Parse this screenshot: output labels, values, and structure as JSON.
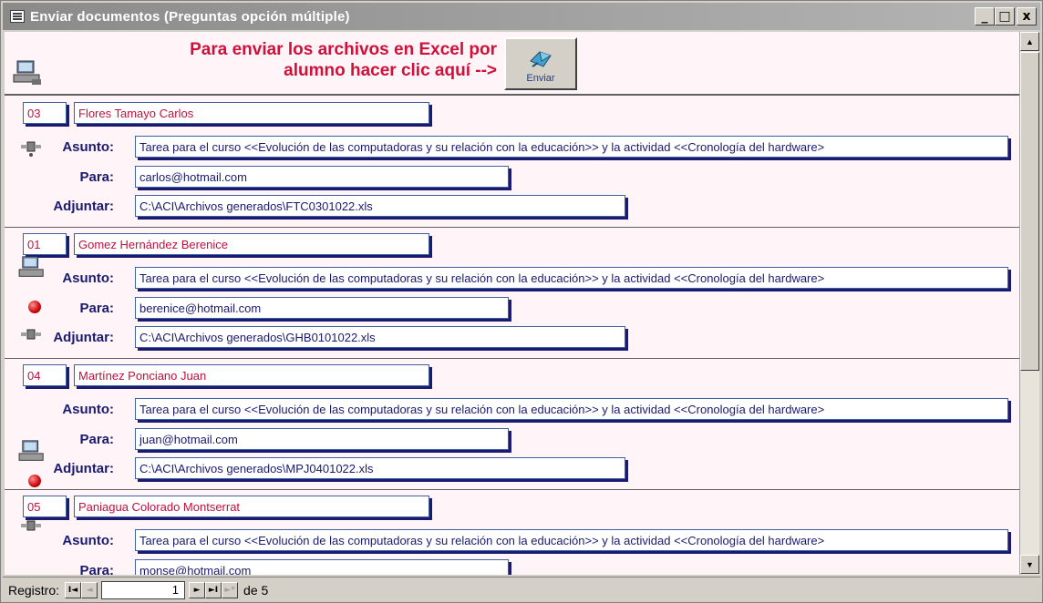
{
  "window": {
    "title": "Enviar documentos (Preguntas opción múltiple)",
    "minimize": "_",
    "maximize": "□",
    "close": "x"
  },
  "header": {
    "message": "Para enviar los archivos en Excel por alumno hacer clic aquí -->",
    "send_button_label": "Enviar"
  },
  "labels": {
    "asunto": "Asunto:",
    "para": "Para:",
    "adjuntar": "Adjuntar:"
  },
  "records": [
    {
      "num": "03",
      "name": "Flores Tamayo Carlos",
      "asunto": "Tarea para el curso <<Evolución de las computadoras y su relación con la educación>> y la actividad <<Cronología del hardware>",
      "para": "carlos@hotmail.com",
      "adjuntar": "C:\\ACI\\Archivos generados\\FTC0301022.xls"
    },
    {
      "num": "01",
      "name": "Gomez Hernández Berenice",
      "asunto": "Tarea para el curso <<Evolución de las computadoras y su relación con la educación>> y la actividad <<Cronología del hardware>",
      "para": "berenice@hotmail.com",
      "adjuntar": "C:\\ACI\\Archivos generados\\GHB0101022.xls"
    },
    {
      "num": "04",
      "name": "Martínez Ponciano Juan",
      "asunto": "Tarea para el curso <<Evolución de las computadoras y su relación con la educación>> y la actividad <<Cronología del hardware>",
      "para": "juan@hotmail.com",
      "adjuntar": "C:\\ACI\\Archivos generados\\MPJ0401022.xls"
    },
    {
      "num": "05",
      "name": "Paniagua Colorado Montserrat",
      "asunto": "Tarea para el curso <<Evolución de las computadoras y su relación con la educación>> y la actividad <<Cronología del hardware>",
      "para": "monse@hotmail.com",
      "adjuntar": ""
    }
  ],
  "navigation": {
    "label": "Registro:",
    "current": "1",
    "total_text": "de 5",
    "first": "I◄",
    "prev": "◄",
    "next": "►",
    "last": "►I",
    "new": "►*"
  }
}
